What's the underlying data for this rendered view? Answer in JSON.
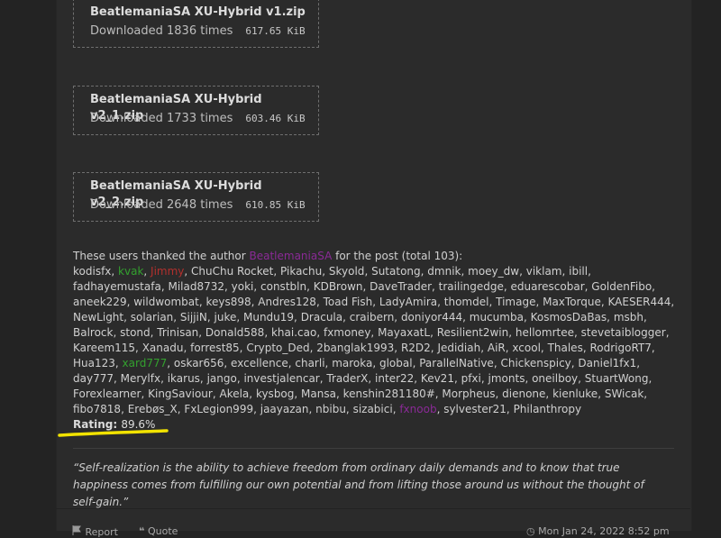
{
  "attachments": [
    {
      "name": "BeatlemaniaSA XU-Hybrid v1.zip",
      "downloads": "Downloaded 1836 times",
      "size": "617.65 KiB"
    },
    {
      "name": "BeatlemaniaSA XU-Hybrid v2_1.zip",
      "downloads": "Downloaded 1733 times",
      "size": "603.46 KiB"
    },
    {
      "name": "BeatlemaniaSA XU-Hybrid v2_2.zip",
      "downloads": "Downloaded 2648 times",
      "size": "610.85 KiB"
    }
  ],
  "thanks": {
    "prefix": "These users thanked the author",
    "author": "BeatlemaniaSA",
    "suffix": "for the post (total 103):"
  },
  "thanked_users": [
    {
      "name": "kodisfx"
    },
    {
      "name": "kvak",
      "color": "#33a12e"
    },
    {
      "name": "Jimmy",
      "color": "#b3302d"
    },
    {
      "name": "ChuChu Rocket"
    },
    {
      "name": "Pikachu"
    },
    {
      "name": "Skyold"
    },
    {
      "name": "Sutatong"
    },
    {
      "name": "dmnik"
    },
    {
      "name": "moey_dw"
    },
    {
      "name": "viklam"
    },
    {
      "name": "ibill"
    },
    {
      "name": "fadhayemustafa"
    },
    {
      "name": "Milad8732"
    },
    {
      "name": "yoki"
    },
    {
      "name": "constbln"
    },
    {
      "name": "KDBrown"
    },
    {
      "name": "DaveTrader"
    },
    {
      "name": "trailingedge"
    },
    {
      "name": "eduarescobar"
    },
    {
      "name": "GoldenFibo"
    },
    {
      "name": "aneek229"
    },
    {
      "name": "wildwombat"
    },
    {
      "name": "keys898"
    },
    {
      "name": "Andres128"
    },
    {
      "name": "Toad Fish"
    },
    {
      "name": "LadyAmira"
    },
    {
      "name": "thomdel"
    },
    {
      "name": "Timage"
    },
    {
      "name": "MaxTorque"
    },
    {
      "name": "KAESER444"
    },
    {
      "name": "NewLight"
    },
    {
      "name": "solarian"
    },
    {
      "name": "SijjiN"
    },
    {
      "name": "juke"
    },
    {
      "name": "Mundu19"
    },
    {
      "name": "Dracula"
    },
    {
      "name": "craibern"
    },
    {
      "name": "doniyor444"
    },
    {
      "name": "mucumba"
    },
    {
      "name": "KosmosDaBas"
    },
    {
      "name": "msbh"
    },
    {
      "name": "Balrock"
    },
    {
      "name": "stond"
    },
    {
      "name": "Trinisan"
    },
    {
      "name": "Donald588"
    },
    {
      "name": "khai.cao"
    },
    {
      "name": "fxmoney"
    },
    {
      "name": "MayaxatL"
    },
    {
      "name": "Resilient2win"
    },
    {
      "name": "hellomrtee"
    },
    {
      "name": "stevetaiblogger"
    },
    {
      "name": "Kareem115"
    },
    {
      "name": "Xanadu"
    },
    {
      "name": "forrest85"
    },
    {
      "name": "Crypto_Ded"
    },
    {
      "name": "2banglak1993"
    },
    {
      "name": "R2D2"
    },
    {
      "name": "Jedidiah"
    },
    {
      "name": "AiR"
    },
    {
      "name": "xcool"
    },
    {
      "name": "Thales"
    },
    {
      "name": "RodrigoRT7"
    },
    {
      "name": "Hua123"
    },
    {
      "name": "xard777",
      "color": "#33a12e"
    },
    {
      "name": "oskar656"
    },
    {
      "name": "excellence"
    },
    {
      "name": "charli"
    },
    {
      "name": "maroka"
    },
    {
      "name": "global"
    },
    {
      "name": "ParallelNative"
    },
    {
      "name": "Chickenspicy"
    },
    {
      "name": "Daniel1fx1"
    },
    {
      "name": "day777"
    },
    {
      "name": "Merylfx"
    },
    {
      "name": "ikarus"
    },
    {
      "name": "jango"
    },
    {
      "name": "investjalencar"
    },
    {
      "name": "TraderX"
    },
    {
      "name": "inter22"
    },
    {
      "name": "Kev21"
    },
    {
      "name": "pfxi"
    },
    {
      "name": "jmonts"
    },
    {
      "name": "oneilboy"
    },
    {
      "name": "StuartWong"
    },
    {
      "name": "Forexlearner"
    },
    {
      "name": "KingSaviour"
    },
    {
      "name": "Akela"
    },
    {
      "name": "kysbog"
    },
    {
      "name": "Mansa"
    },
    {
      "name": "kenshin281180#"
    },
    {
      "name": "Morpheus"
    },
    {
      "name": "dienone"
    },
    {
      "name": "kienluke"
    },
    {
      "name": "SWicak"
    },
    {
      "name": "fibo7818"
    },
    {
      "name": "Erebøs_X"
    },
    {
      "name": "FxLegion999"
    },
    {
      "name": "jaayazan"
    },
    {
      "name": "nbibu"
    },
    {
      "name": "sizabici"
    },
    {
      "name": "fxnoob",
      "color": "#8a2a96"
    },
    {
      "name": "sylvester21"
    },
    {
      "name": "Philanthropy"
    }
  ],
  "rating": {
    "label": "Rating:",
    "value": "89.6%"
  },
  "highlight_color": "#f2e300",
  "signature": "“Self-realization is the ability to achieve freedom from ordinary daily demands and to know that true happiness comes from fulfilling our own potential and from lifting those around us without the thought of self-gain.”",
  "footer": {
    "report_label": "Report",
    "quote_label": "Quote",
    "timestamp": "Mon Jan 24, 2022 8:52 pm"
  },
  "icons": {
    "report": "flag-icon",
    "quote": "quote-icon",
    "time": "clock-icon"
  }
}
